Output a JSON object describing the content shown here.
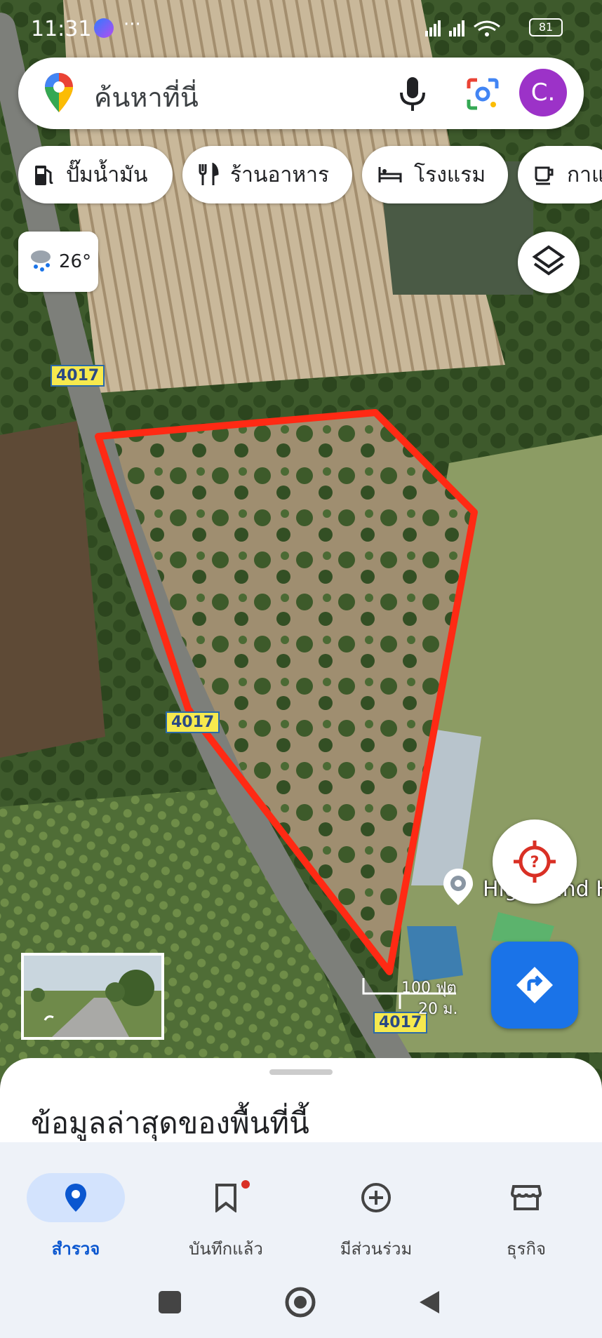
{
  "status_bar": {
    "time": "11:31",
    "dots": "···",
    "battery": "81"
  },
  "search": {
    "placeholder": "ค้นหาที่นี่",
    "avatar_letter": "C."
  },
  "chips": [
    {
      "label": "ปั๊มน้ำมัน",
      "icon": "gas-station-icon"
    },
    {
      "label": "ร้านอาหาร",
      "icon": "restaurant-icon"
    },
    {
      "label": "โรงแรม",
      "icon": "hotel-icon"
    },
    {
      "label": "กาแฟ",
      "icon": "coffee-icon"
    }
  ],
  "weather": {
    "temp": "26°",
    "icon": "rain-cloud-icon"
  },
  "map": {
    "road_labels": [
      "4017",
      "4017",
      "4017"
    ],
    "place_label": "High Land Hy",
    "scale_ft": "100 ฟุต",
    "scale_m": "20 ม.",
    "boundary_color": "#ff2a14"
  },
  "sheet": {
    "title": "ข้อมูลล่าสุดของพื้นที่นี้"
  },
  "bottom_nav": [
    {
      "label": "สำรวจ",
      "icon": "location-pin-icon",
      "active": true
    },
    {
      "label": "บันทึกแล้ว",
      "icon": "bookmark-icon",
      "active": false
    },
    {
      "label": "มีส่วนร่วม",
      "icon": "add-circle-icon",
      "active": false
    },
    {
      "label": "ธุรกิจ",
      "icon": "storefront-icon",
      "active": false
    }
  ],
  "colors": {
    "accent": "#1a73e8",
    "avatar": "#9c32c8",
    "nav_active": "#0b57d0"
  }
}
